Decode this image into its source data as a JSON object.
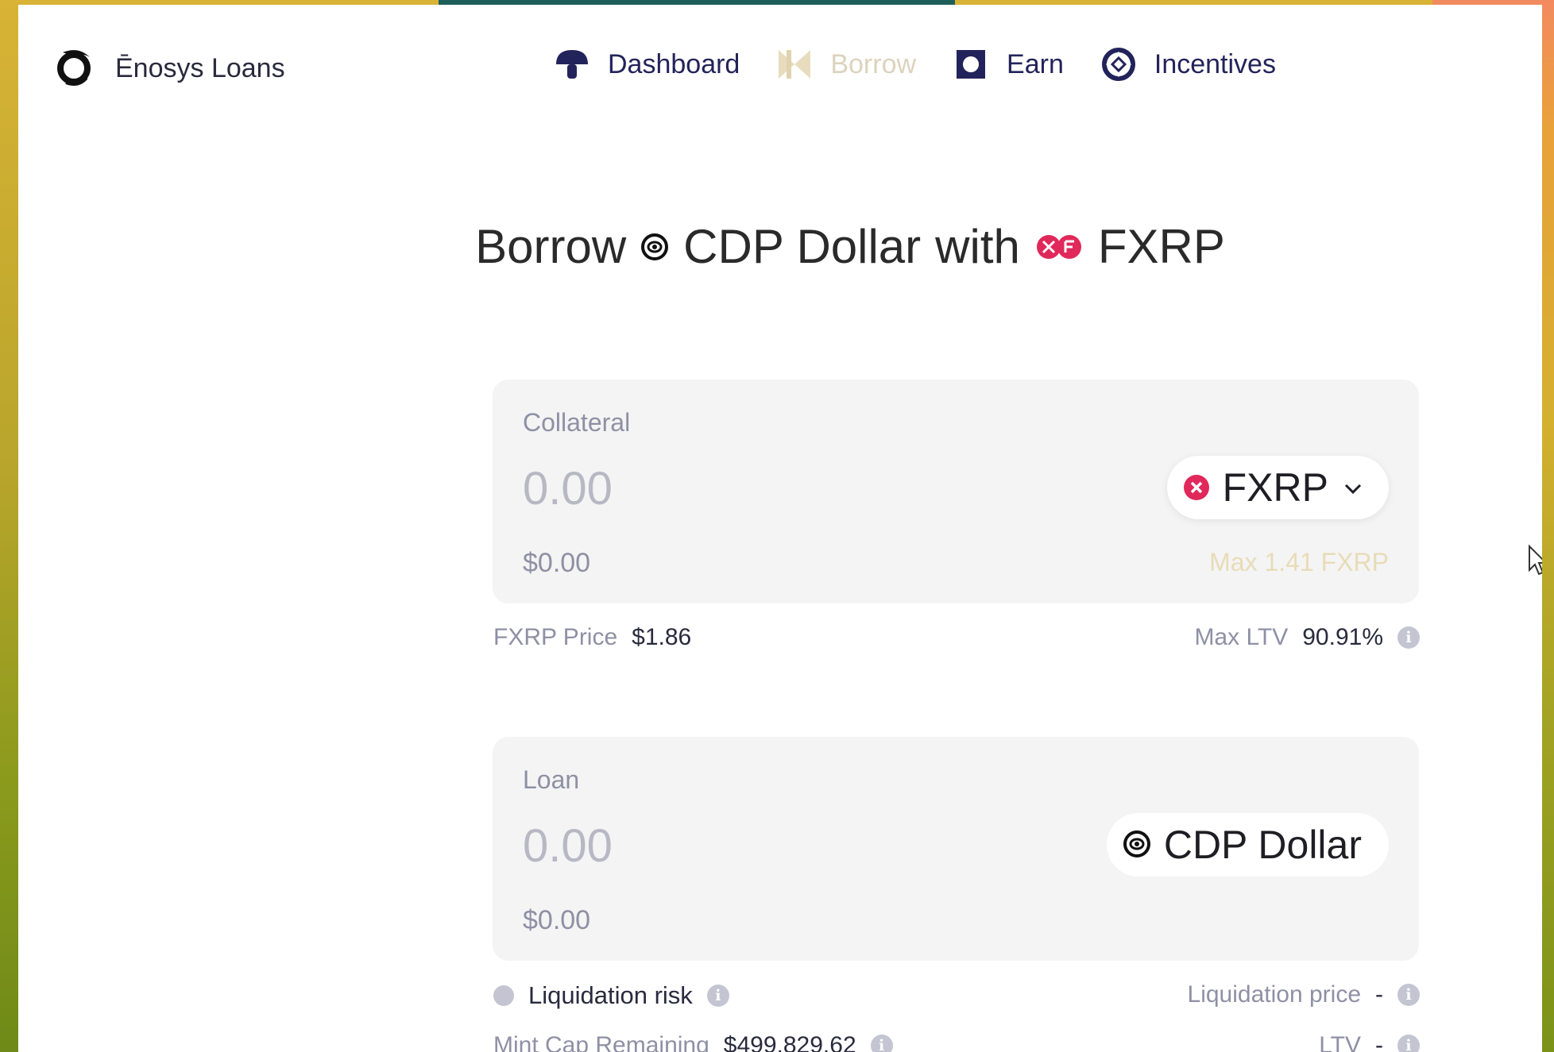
{
  "colors": {
    "accent_navy": "#23235b",
    "fxrp_pink": "#e0285a",
    "disabled_nav": "#dcd3be",
    "panel_bg": "#f4f4f4"
  },
  "brand": {
    "name": "Ēnosys Loans",
    "icon": "enosys-swirl-logo"
  },
  "nav": [
    {
      "label": "Dashboard",
      "icon": "mushroom-icon",
      "state": "active"
    },
    {
      "label": "Borrow",
      "icon": "bowtie-icon",
      "state": "current"
    },
    {
      "label": "Earn",
      "icon": "square-frame-icon",
      "state": "active"
    },
    {
      "label": "Incentives",
      "icon": "diamond-circle-icon",
      "state": "active"
    }
  ],
  "heading": {
    "part1": "Borrow",
    "stable": "CDP Dollar",
    "with": "with",
    "collateral": "FXRP"
  },
  "collateral_panel": {
    "label": "Collateral",
    "amount_placeholder": "0.00",
    "usd_value": "$0.00",
    "token": "FXRP",
    "max_text": "Max 1.41 FXRP"
  },
  "collateral_meta": {
    "price_label": "FXRP Price",
    "price_value": "$1.86",
    "ltv_label": "Max LTV",
    "ltv_value": "90.91%"
  },
  "loan_panel": {
    "label": "Loan",
    "amount_placeholder": "0.00",
    "usd_value": "$0.00",
    "token": "CDP Dollar"
  },
  "loan_meta": {
    "risk_label": "Liquidation risk",
    "liq_price_label": "Liquidation price",
    "liq_price_value": "-",
    "mint_cap_label": "Mint Cap Remaining",
    "mint_cap_value": "$499,829.62",
    "ltv_label": "LTV",
    "ltv_value": "-"
  }
}
